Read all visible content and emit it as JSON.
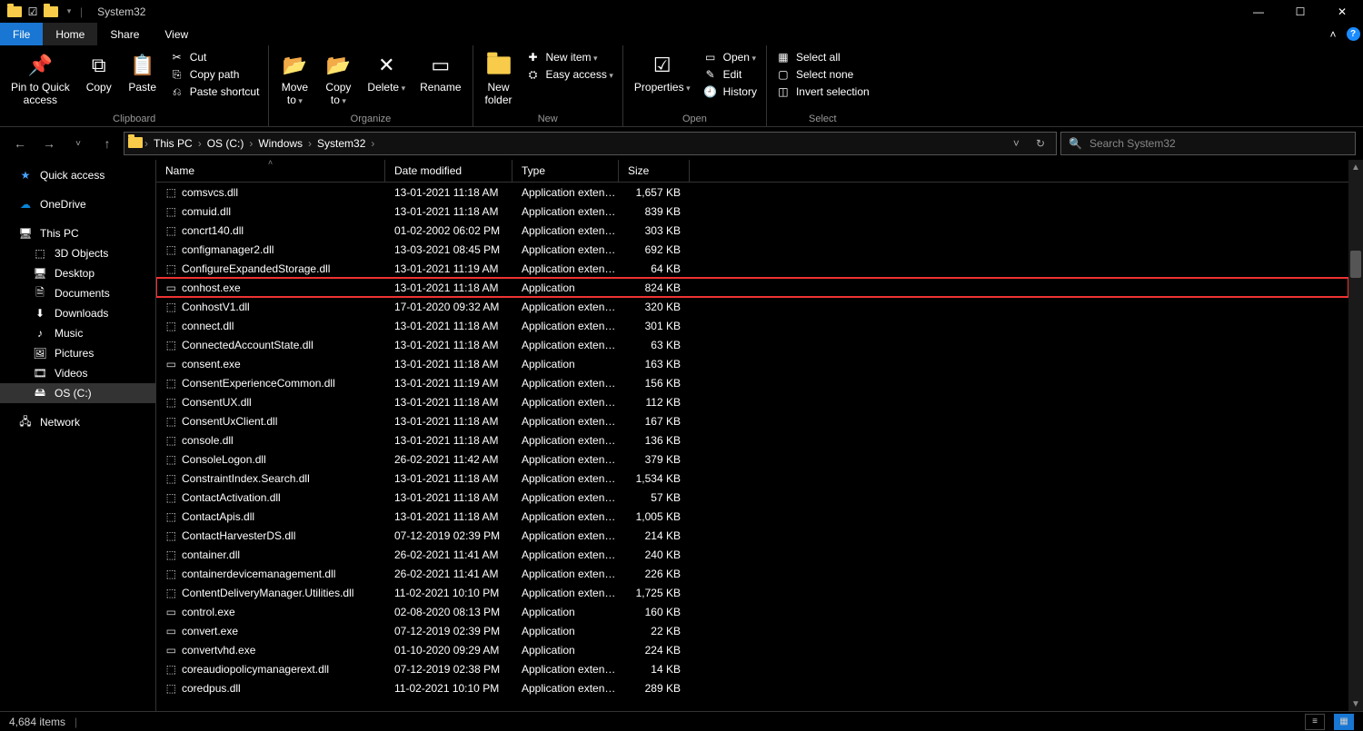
{
  "title": "System32",
  "tabs": {
    "file": "File",
    "home": "Home",
    "share": "Share",
    "view": "View"
  },
  "ribbon": {
    "clipboard": {
      "label": "Clipboard",
      "pin": "Pin to Quick\naccess",
      "copy": "Copy",
      "paste": "Paste",
      "cut": "Cut",
      "copy_path": "Copy path",
      "paste_shortcut": "Paste shortcut"
    },
    "organize": {
      "label": "Organize",
      "move_to": "Move\nto",
      "copy_to": "Copy\nto",
      "delete": "Delete",
      "rename": "Rename"
    },
    "new": {
      "label": "New",
      "new_folder": "New\nfolder",
      "new_item": "New item",
      "easy_access": "Easy access"
    },
    "open": {
      "label": "Open",
      "properties": "Properties",
      "open": "Open",
      "edit": "Edit",
      "history": "History"
    },
    "select": {
      "label": "Select",
      "select_all": "Select all",
      "select_none": "Select none",
      "invert": "Invert selection"
    }
  },
  "breadcrumb": [
    "This PC",
    "OS (C:)",
    "Windows",
    "System32"
  ],
  "search": {
    "placeholder": "Search System32"
  },
  "nav": {
    "quick_access": "Quick access",
    "onedrive": "OneDrive",
    "this_pc": "This PC",
    "children": [
      "3D Objects",
      "Desktop",
      "Documents",
      "Downloads",
      "Music",
      "Pictures",
      "Videos",
      "OS (C:)"
    ],
    "network": "Network"
  },
  "columns": {
    "name": "Name",
    "date": "Date modified",
    "type": "Type",
    "size": "Size"
  },
  "files": [
    {
      "name": "comsvcs.dll",
      "date": "13-01-2021 11:18 AM",
      "type": "Application extens...",
      "size": "1,657 KB",
      "icon": "dll"
    },
    {
      "name": "comuid.dll",
      "date": "13-01-2021 11:18 AM",
      "type": "Application extens...",
      "size": "839 KB",
      "icon": "dll"
    },
    {
      "name": "concrt140.dll",
      "date": "01-02-2002 06:02 PM",
      "type": "Application extens...",
      "size": "303 KB",
      "icon": "dll"
    },
    {
      "name": "configmanager2.dll",
      "date": "13-03-2021 08:45 PM",
      "type": "Application extens...",
      "size": "692 KB",
      "icon": "dll"
    },
    {
      "name": "ConfigureExpandedStorage.dll",
      "date": "13-01-2021 11:19 AM",
      "type": "Application extens...",
      "size": "64 KB",
      "icon": "dll"
    },
    {
      "name": "conhost.exe",
      "date": "13-01-2021 11:18 AM",
      "type": "Application",
      "size": "824 KB",
      "icon": "exe",
      "highlight": true
    },
    {
      "name": "ConhostV1.dll",
      "date": "17-01-2020 09:32 AM",
      "type": "Application extens...",
      "size": "320 KB",
      "icon": "dll"
    },
    {
      "name": "connect.dll",
      "date": "13-01-2021 11:18 AM",
      "type": "Application extens...",
      "size": "301 KB",
      "icon": "dll"
    },
    {
      "name": "ConnectedAccountState.dll",
      "date": "13-01-2021 11:18 AM",
      "type": "Application extens...",
      "size": "63 KB",
      "icon": "dll"
    },
    {
      "name": "consent.exe",
      "date": "13-01-2021 11:18 AM",
      "type": "Application",
      "size": "163 KB",
      "icon": "exe"
    },
    {
      "name": "ConsentExperienceCommon.dll",
      "date": "13-01-2021 11:19 AM",
      "type": "Application extens...",
      "size": "156 KB",
      "icon": "dll"
    },
    {
      "name": "ConsentUX.dll",
      "date": "13-01-2021 11:18 AM",
      "type": "Application extens...",
      "size": "112 KB",
      "icon": "dll"
    },
    {
      "name": "ConsentUxClient.dll",
      "date": "13-01-2021 11:18 AM",
      "type": "Application extens...",
      "size": "167 KB",
      "icon": "dll"
    },
    {
      "name": "console.dll",
      "date": "13-01-2021 11:18 AM",
      "type": "Application extens...",
      "size": "136 KB",
      "icon": "dll"
    },
    {
      "name": "ConsoleLogon.dll",
      "date": "26-02-2021 11:42 AM",
      "type": "Application extens...",
      "size": "379 KB",
      "icon": "dll"
    },
    {
      "name": "ConstraintIndex.Search.dll",
      "date": "13-01-2021 11:18 AM",
      "type": "Application extens...",
      "size": "1,534 KB",
      "icon": "dll"
    },
    {
      "name": "ContactActivation.dll",
      "date": "13-01-2021 11:18 AM",
      "type": "Application extens...",
      "size": "57 KB",
      "icon": "dll"
    },
    {
      "name": "ContactApis.dll",
      "date": "13-01-2021 11:18 AM",
      "type": "Application extens...",
      "size": "1,005 KB",
      "icon": "dll"
    },
    {
      "name": "ContactHarvesterDS.dll",
      "date": "07-12-2019 02:39 PM",
      "type": "Application extens...",
      "size": "214 KB",
      "icon": "dll"
    },
    {
      "name": "container.dll",
      "date": "26-02-2021 11:41 AM",
      "type": "Application extens...",
      "size": "240 KB",
      "icon": "dll"
    },
    {
      "name": "containerdevicemanagement.dll",
      "date": "26-02-2021 11:41 AM",
      "type": "Application extens...",
      "size": "226 KB",
      "icon": "dll"
    },
    {
      "name": "ContentDeliveryManager.Utilities.dll",
      "date": "11-02-2021 10:10 PM",
      "type": "Application extens...",
      "size": "1,725 KB",
      "icon": "dll"
    },
    {
      "name": "control.exe",
      "date": "02-08-2020 08:13 PM",
      "type": "Application",
      "size": "160 KB",
      "icon": "exe"
    },
    {
      "name": "convert.exe",
      "date": "07-12-2019 02:39 PM",
      "type": "Application",
      "size": "22 KB",
      "icon": "exe"
    },
    {
      "name": "convertvhd.exe",
      "date": "01-10-2020 09:29 AM",
      "type": "Application",
      "size": "224 KB",
      "icon": "exe"
    },
    {
      "name": "coreaudiopolicymanagerext.dll",
      "date": "07-12-2019 02:38 PM",
      "type": "Application extens...",
      "size": "14 KB",
      "icon": "dll"
    },
    {
      "name": "coredpus.dll",
      "date": "11-02-2021 10:10 PM",
      "type": "Application extens...",
      "size": "289 KB",
      "icon": "dll"
    }
  ],
  "status": {
    "count": "4,684 items"
  },
  "icons": {
    "dll": "▤",
    "exe": "▭",
    "nav": {
      "quick": "★",
      "onedrive": "☁",
      "pc": "🖥",
      "obj3d": "⬚",
      "desktop": "🖥",
      "docs": "🗎",
      "down": "⬇",
      "music": "♪",
      "pics": "🖼",
      "vids": "🎞",
      "drive": "🖴",
      "net": "🖧"
    }
  }
}
